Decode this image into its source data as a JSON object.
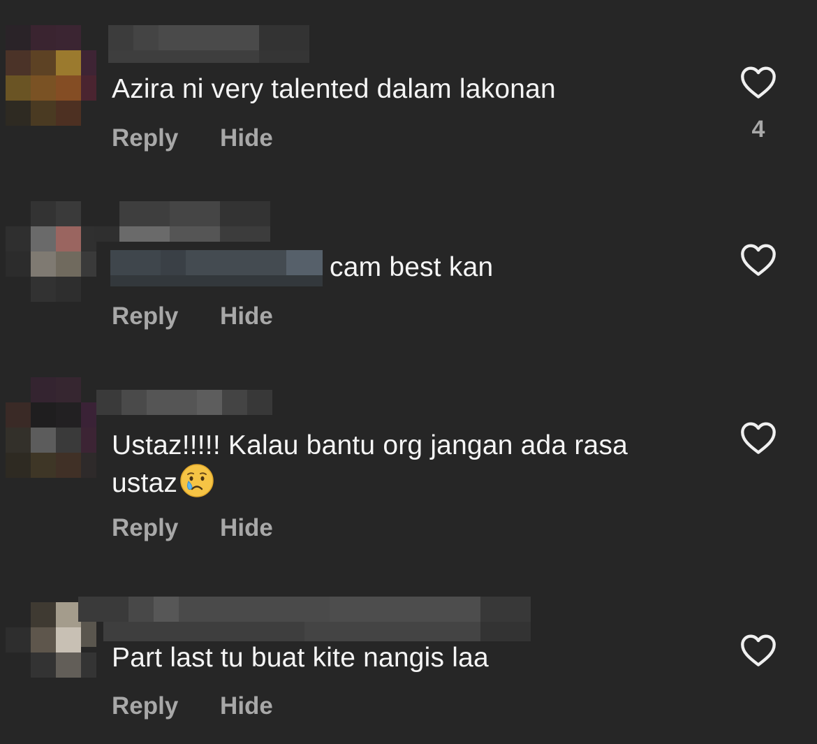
{
  "colors": {
    "background": "#262626",
    "text": "#f5f5f5",
    "secondary": "#a8a8a8"
  },
  "comments": [
    {
      "text": "Azira ni very talented dalam lakonan",
      "reply_label": "Reply",
      "hide_label": "Hide",
      "like_count": "4",
      "like_icon": "heart-outline-icon"
    },
    {
      "text": "cam best kan",
      "reply_label": "Reply",
      "hide_label": "Hide",
      "like_icon": "heart-outline-icon"
    },
    {
      "text_line1": "Ustaz!!!!! Kalau bantu org jangan ada rasa",
      "text_line2": "ustaz",
      "emoji": "crying-face-emoji",
      "reply_label": "Reply",
      "hide_label": "Hide",
      "like_icon": "heart-outline-icon"
    },
    {
      "text": "Part last tu buat kite nangis laa",
      "reply_label": "Reply",
      "hide_label": "Hide",
      "like_icon": "heart-outline-icon"
    }
  ]
}
